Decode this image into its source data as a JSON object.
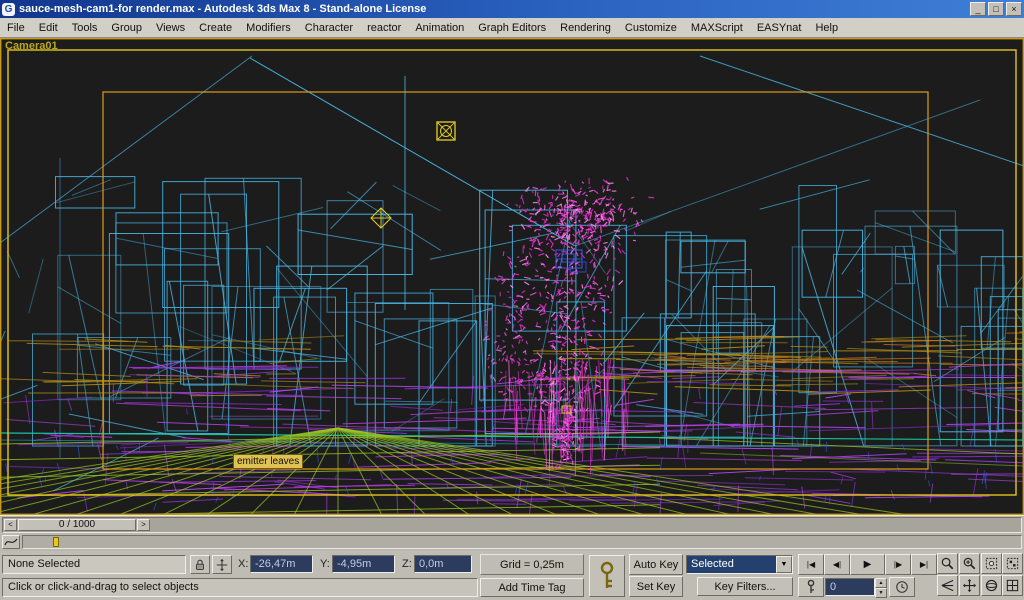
{
  "window": {
    "title": "sauce-mesh-cam1-for render.max - Autodesk 3ds Max 8  - Stand-alone License",
    "app_icon_glyph": "G",
    "minimize_glyph": "_",
    "maximize_glyph": "□",
    "close_glyph": "×"
  },
  "menu": {
    "items": [
      "File",
      "Edit",
      "Tools",
      "Group",
      "Views",
      "Create",
      "Modifiers",
      "Character",
      "reactor",
      "Animation",
      "Graph Editors",
      "Rendering",
      "Customize",
      "MAXScript",
      "EASYnat",
      "Help"
    ]
  },
  "viewport": {
    "label": "Camera01",
    "object_tag": "emitter leaves",
    "colors": {
      "background": "#1c1c1c",
      "wireframe_cyan": "#4ab9e8",
      "particles_magenta": "#f54ae0",
      "wireframe_purple": "#9b36e6",
      "ground_green": "#9ccb20",
      "band_olive": "#b38f16",
      "band_orange": "#d27f1c",
      "teal_line": "#17c9a6",
      "safe_frame_yellow": "#e6c41c",
      "safe_frame_inner": "#de9a1a",
      "helper_yellow": "#e8d020",
      "selection_blue": "#3b5bff"
    }
  },
  "timeline": {
    "slider_label": "0 / 1000",
    "left_arrow_glyph": "<",
    "right_arrow_glyph": ">"
  },
  "status": {
    "selection": "None Selected",
    "prompt": "Click or click-and-drag to select objects",
    "x_label": "X:",
    "x_value": "-26,47m",
    "y_label": "Y:",
    "y_value": "-4,95m",
    "z_label": "Z:",
    "z_value": "0,0m",
    "grid_label": "Grid = 0,25m",
    "time_tag_label": "Add Time Tag"
  },
  "animation": {
    "auto_key_label": "Auto Key",
    "set_key_label": "Set Key",
    "key_mode_dropdown_value": "Selected",
    "key_filters_label": "Key Filters...",
    "frame_value": "0",
    "transport": {
      "go_to_start": "|◀",
      "previous_frame": "◀|",
      "play": "▶",
      "next_frame": "|▶",
      "go_to_end": "▶|"
    }
  },
  "icons": {
    "spinner_up": "▲",
    "spinner_down": "▼",
    "dropdown_arrow": "▼"
  }
}
